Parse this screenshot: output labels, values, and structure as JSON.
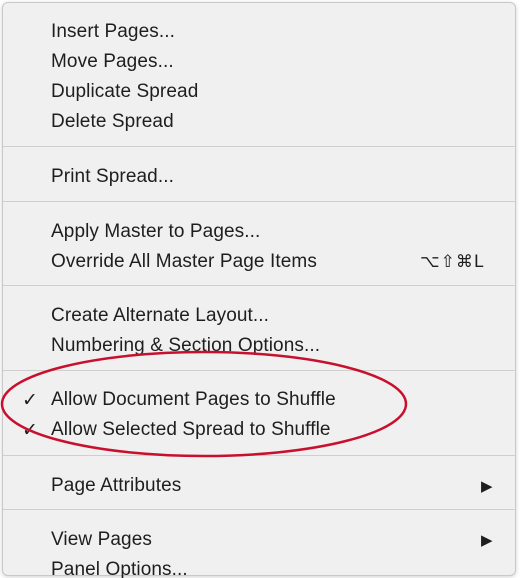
{
  "menu": {
    "items": [
      {
        "label": "Insert Pages..."
      },
      {
        "label": "Move Pages..."
      },
      {
        "label": "Duplicate Spread"
      },
      {
        "label": "Delete Spread"
      },
      {
        "label": "Print Spread..."
      },
      {
        "label": "Apply Master to Pages..."
      },
      {
        "label": "Override All Master Page Items",
        "shortcut": "⌥⇧⌘L"
      },
      {
        "label": "Create Alternate Layout..."
      },
      {
        "label": "Numbering & Section Options..."
      },
      {
        "label": "Allow Document Pages to Shuffle",
        "check": "✓",
        "checked": true
      },
      {
        "label": "Allow Selected Spread to Shuffle",
        "check": "✓",
        "checked": true
      },
      {
        "label": "Page Attributes",
        "submenu": "▶"
      },
      {
        "label": "View Pages",
        "submenu": "▶"
      },
      {
        "label": "Panel Options..."
      }
    ]
  },
  "colors": {
    "menu_background": "#f0f0f0",
    "separator": "#cfcfcf",
    "annotation_ring": "#c8102e"
  }
}
